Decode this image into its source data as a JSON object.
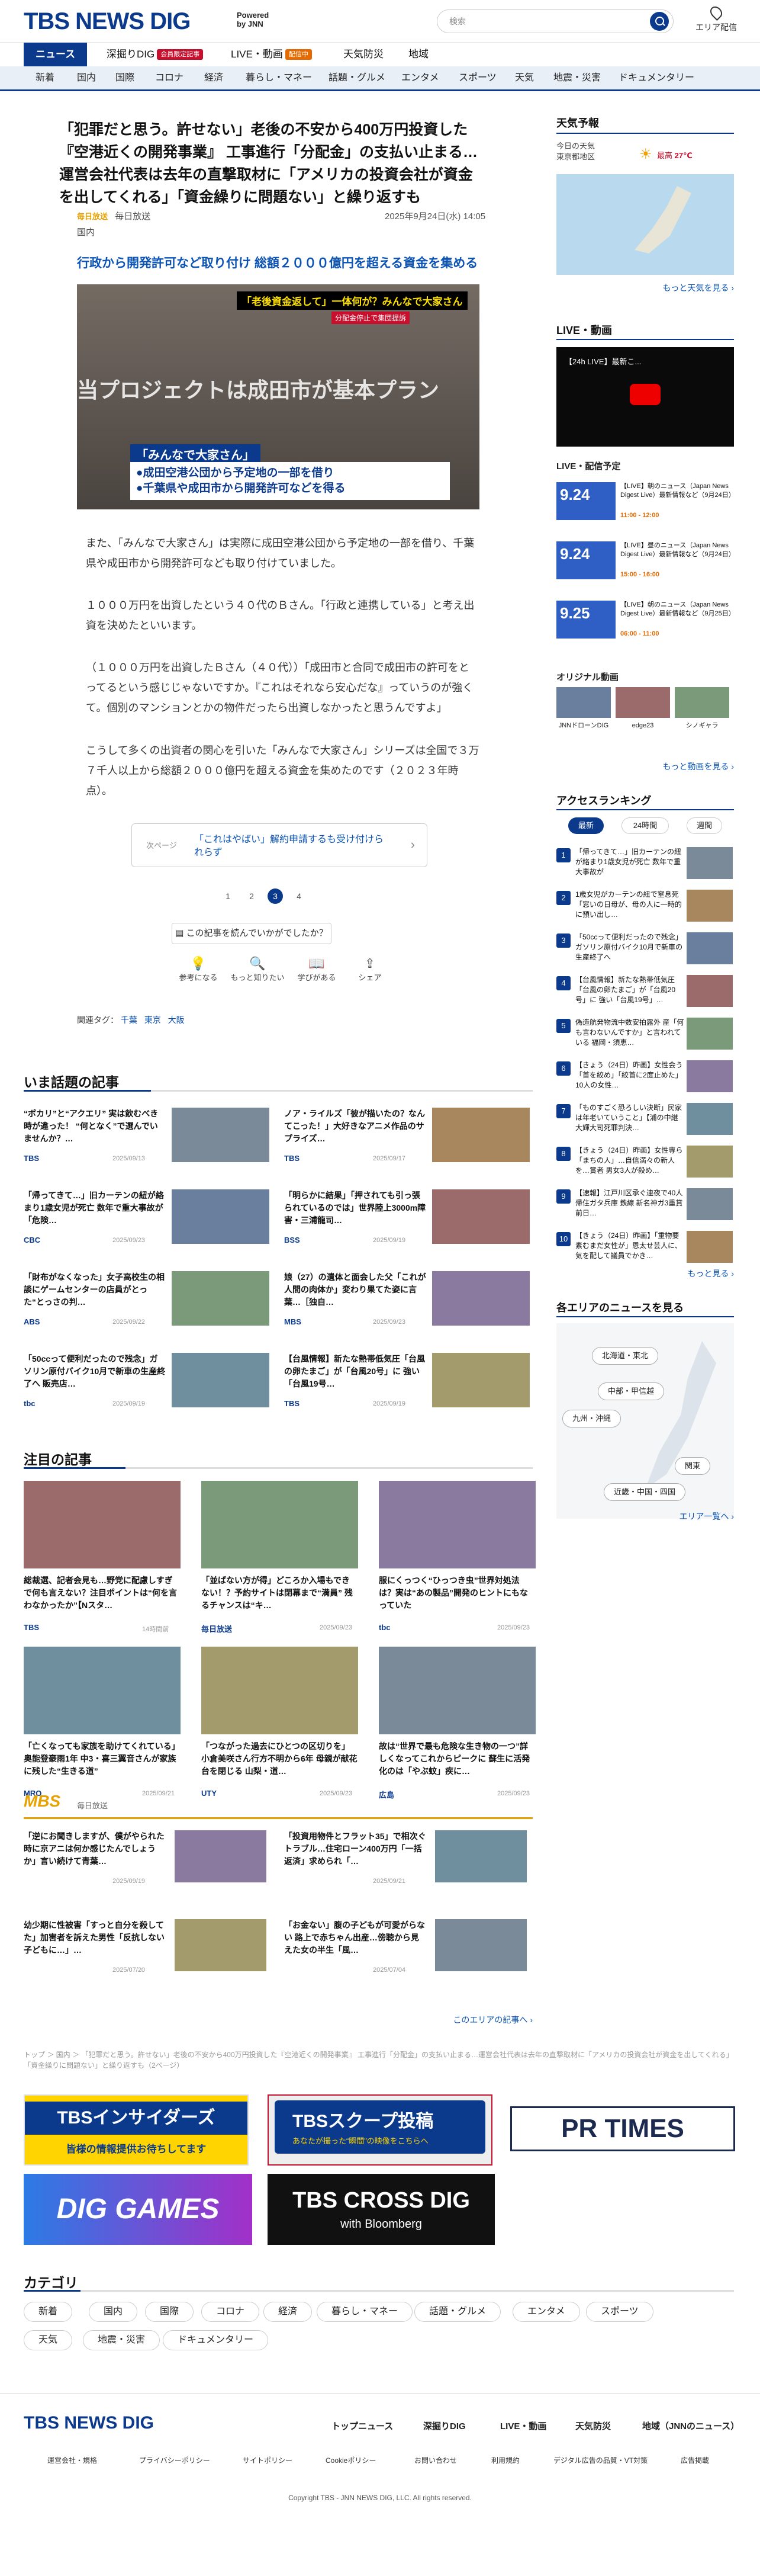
{
  "header": {
    "logo": "TBS NEWS DIG",
    "powered": "Powered",
    "by": "by JNN",
    "search_placeholder": "検索",
    "area_label": "エリア配信"
  },
  "nav1": [
    {
      "label": "ニュース"
    },
    {
      "label": "深掘りDIG",
      "badge": "会員限定記事"
    },
    {
      "label": "LIVE・動画",
      "badge": "配信中"
    },
    {
      "label": "天気防災"
    },
    {
      "label": "地域"
    }
  ],
  "nav2": [
    "新着",
    "国内",
    "国際",
    "コロナ",
    "経済",
    "暮らし・マネー",
    "話題・グルメ",
    "エンタメ",
    "スポーツ",
    "天気",
    "地震・災害",
    "ドキュメンタリー"
  ],
  "article": {
    "title": "「犯罪だと思う。許せない」老後の不安から400万円投資した『空港近くの開発事業』 工事進行「分配金」の支払い止まる…運営会社代表は去年の直撃取材に「アメリカの投資会社が資金を出してくれる」「資金繰りに問題ない」と繰り返すも",
    "source": "毎日放送",
    "date": "2025年9月24日(水) 14:05",
    "category": "国内",
    "subheading": "行政から開発許可など取り付け 総額２０００億円を超える資金を集める",
    "hero_caption_top": "「老後資金返して」一体何が？みんなで大家さん",
    "hero_caption_mid": "当プロジェクトは成田市が基本プラン",
    "hero_caption_red": "分配金停止で集団提訴",
    "hero_label": "「みんなで大家さん」",
    "hero_bullet1": "●成田空港公団から予定地の一部を借り",
    "hero_bullet2": "●千葉県や成田市から開発許可などを得る",
    "p1": "また、「みんなで大家さん」は実際に成田空港公団から予定地の一部を借り、千葉県や成田市から開発許可なども取り付けていました。",
    "p2": "１０００万円を出資したという４０代のＢさん。「行政と連携している」と考え出資を決めたといいます。",
    "p3": "（１０００万円を出資したＢさん（４０代））「成田市と合同で成田市の許可をとってるという感じじゃないですか。『これはそれなら安心だな』っていうのが強くて。個別のマンションとかの物件だったら出資しなかったと思うんですよ」",
    "p4": "こうして多くの出資者の関心を引いた「みんなで大家さん」シリーズは全国で３万７千人以上から総額２０００億円を超える資金を集めたのです（２０２３年時点）。",
    "next_label": "次ページ",
    "next_title": "「これはやばい」解約申請するも受け付けられらず",
    "pages": [
      "1",
      "2",
      "3",
      "4"
    ],
    "ask": "この記事を読んでいかがでしたか？",
    "reactions": [
      "参考になる",
      "もっと知りたい",
      "学びがある",
      "シェア"
    ],
    "tags_label": "関連タグ：",
    "tags": [
      "千葉",
      "東京",
      "大阪"
    ]
  },
  "trending": {
    "title": "いま話題の記事",
    "items": [
      {
        "t": "“ポカリ”と“アクエリ” 実は飲むべき時が違った！ “何となく”で選んでいませんか？…",
        "s": "TBS",
        "d": "2025/09/13"
      },
      {
        "t": "ノア・ライルズ「彼が描いたの？なんてこった！」大好きなアニメ作品のサプライズ…",
        "s": "TBS",
        "d": "2025/09/17"
      },
      {
        "t": "「帰ってきて…」旧カーテンの紐が絡まり1歳女児が死亡 数年で重大事故が「危険…",
        "s": "CBC",
        "d": "2025/09/23"
      },
      {
        "t": "「明らかに結果」「押されても引っ張られているのでは」世界陸上3000m障害・三浦龍司…",
        "s": "BSS",
        "d": "2025/09/19"
      },
      {
        "t": "「財布がなくなった」女子高校生の相談にゲームセンターの店員がとった“とっさの判…",
        "s": "ABS",
        "d": "2025/09/22"
      },
      {
        "t": "娘（27）の遺体と面会した父「これが人間の肉体か」変わり果てた姿に言葉…［独自…",
        "s": "MBS",
        "d": "2025/09/23"
      },
      {
        "t": "「50ccって便利だったので残念」ガソリン原付バイク10月で新車の生産終了へ 販売店…",
        "s": "tbc",
        "d": "2025/09/19"
      },
      {
        "t": "【台風情報】新たな熱帯低気圧「台風の卵たまご」が「台風20号」に 強い「台風19号…",
        "s": "TBS",
        "d": "2025/09/19"
      }
    ]
  },
  "featured": {
    "title": "注目の記事",
    "items": [
      {
        "t": "総裁選、記者会見も…野党に配慮しすぎで何も言えない？注目ポイントは“何を言わなかったか”【Nスタ…",
        "s": "TBS",
        "d": "14時間前"
      },
      {
        "t": "「並ばない方が得」どころか入場もできない！？予約サイトは閉幕まで“満員” 残るチャンスは“キ…",
        "s": "毎日放送",
        "d": "2025/09/23"
      },
      {
        "t": "服にくっつく“ひっつき虫”世界対処法は？実は“あの製品”開発のヒントにもなっていた",
        "s": "tbc",
        "d": "2025/09/23"
      },
      {
        "t": "「亡くなっても家族を助けてくれている」奥能登豪雨1年 中3・喜三翼音さんが家族に残した“生きる道”",
        "s": "MRO",
        "d": "2025/09/21"
      },
      {
        "t": "「つながった過去にひとつの区切りを」小倉美咲さん行方不明から6年 母親が献花台を閉じる 山梨・道…",
        "s": "UTY",
        "d": "2025/09/23"
      },
      {
        "t": "故は“世界で最も危険な生き物の一つ”詳しくなってこれからピークに 蘇生に活発化のは「やぶ蚊」疾に…",
        "s": "広島",
        "d": "2025/09/23"
      }
    ]
  },
  "mbs": {
    "logo": "MBS",
    "label": "毎日放送",
    "items": [
      {
        "t": "「逆にお聞きしますが、僕がやられた時に京アニは何か感じたんでしょうか」言い続けて青葉…",
        "d": "2025/09/19"
      },
      {
        "t": "「投資用物件とフラット35」で相次ぐトラブル…住宅ローン400万円「一括返済」求められ「…",
        "d": "2025/09/21"
      },
      {
        "t": "幼少期に性被害「すっと自分を殺してた」加害者を訴えた男性「反抗しない子どもに…」…",
        "d": "2025/07/20"
      },
      {
        "t": "「お金ない」腹の子どもが可愛がらない 路上で赤ちゃん出産…傍聴から見えた女の半生「風…",
        "d": "2025/07/04"
      }
    ],
    "more": "このエリアの記事へ ›"
  },
  "breadcrumb": "トップ ＞ 国内 ＞ 「犯罪だと思う。許せない」老後の不安から400万円投資した『空港近くの開発事業』 工事進行「分配金」の支払い止まる…運営会社代表は去年の直撃取材に「アメリカの投資会社が資金を出してくれる」「資金繰りに問題ない」と繰り返すも（2ページ）",
  "banners": {
    "insider": "TBSインサイダーズ",
    "insider_sub": "皆様の情報提供お待ちしてます",
    "scoop": "TBSスクープ投稿",
    "scoop_sub": "あなたが撮った“瞬間”の映像をこちらへ",
    "prtimes": "PR TIMES",
    "diggames": "DIG GAMES",
    "crossdig": "TBS CROSS DIG",
    "crossdig_sub": "with Bloomberg"
  },
  "categories": {
    "title": "カテゴリ",
    "items": [
      "新着",
      "国内",
      "国際",
      "コロナ",
      "経済",
      "暮らし・マネー",
      "話題・グルメ",
      "エンタメ",
      "スポーツ",
      "天気",
      "地震・災害",
      "ドキュメンタリー"
    ]
  },
  "footer": {
    "nav": [
      "トップニュース",
      "深掘りDIG",
      "LIVE・動画",
      "天気防災",
      "地域（JNNのニュース）"
    ],
    "links": [
      "運営会社・規格",
      "プライバシーポリシー",
      "サイトポリシー",
      "Cookieポリシー",
      "お問い合わせ",
      "利用規約",
      "デジタル広告の品質・VT対策",
      "広告掲載"
    ],
    "copyright": "Copyright TBS - JNN NEWS DIG, LLC. All rights reserved."
  },
  "side": {
    "weather": {
      "title": "天気予報",
      "today": "今日の天気",
      "region": "東京都地区",
      "max_label": "最高",
      "max": "27℃",
      "more": "もっと天気を見る ›"
    },
    "live": {
      "title": "LIVE・動画",
      "video_title": "【24h LIVE】最新こ...",
      "schedule_title": "LIVE・配信予定",
      "items": [
        {
          "date": "9.24",
          "t": "【LIVE】朝のニュース（Japan News Digest Live）最新情報など（9月24日）",
          "time": "11:00 - 12:00"
        },
        {
          "date": "9.24",
          "t": "【LIVE】昼のニュース（Japan News Digest Live）最新情報など（9月24日）",
          "time": "15:00 - 16:00"
        },
        {
          "date": "9.25",
          "t": "【LIVE】朝のニュース（Japan News Digest Live）最新情報など（9月25日）",
          "time": "06:00 - 11:00"
        }
      ],
      "original_title": "オリジナル動画",
      "originals": [
        "JNNドローンDIG",
        "edge23",
        "シノギャラ"
      ],
      "more": "もっと動画を見る ›"
    },
    "ranking": {
      "title": "アクセスランキング",
      "tabs": [
        "最新",
        "24時間",
        "週間"
      ],
      "items": [
        "「帰ってきて…」旧カーテンの紐が絡まり1歳女児が死亡 数年で重大事故が",
        "1歳女児がカーテンの紐で窒息死「窓いの日母が、母の人に一時的に預い出し…",
        "「50ccって便利だったので残念」ガソリン原付バイク10月で新車の生産終了へ",
        "【台風情報】新たな熱帯低気圧「台風の卵たまご」が「台風20号」に 強い「台風19号」…",
        "偽造航発物流中数安拍露外 産「何も言わないんですか」と言われている 福岡・須恵…",
        "【きょう（24日）昨画】女性会う「首を絞め」「絞首に2度止めた」10人の女性…",
        "「ものすごく恐ろしい決断」民家は年老いていうこと」【浦の中継大輝大司死罪判決…",
        "【きょう（24日）昨画】女性専ら「まちの人」…自信満々の新人を…賞者 男女3人が殺め…",
        "【速報】江戸川区承ぐ連夜で40人帰住ガタ兵庫 鉄線 新名神ガ3重賞前日…",
        "【きょう（24日）昨画】「重物要素むまだ女性が」恩太せ芸人に、気を配して議員でかき…"
      ],
      "more": "もっと見る ›"
    },
    "area": {
      "title": "各エリアのニュースを見る",
      "regions": [
        "北海道・東北",
        "中部・甲信越",
        "九州・沖縄",
        "関東",
        "近畿・中国・四国"
      ],
      "more": "エリア一覧へ ›"
    }
  }
}
